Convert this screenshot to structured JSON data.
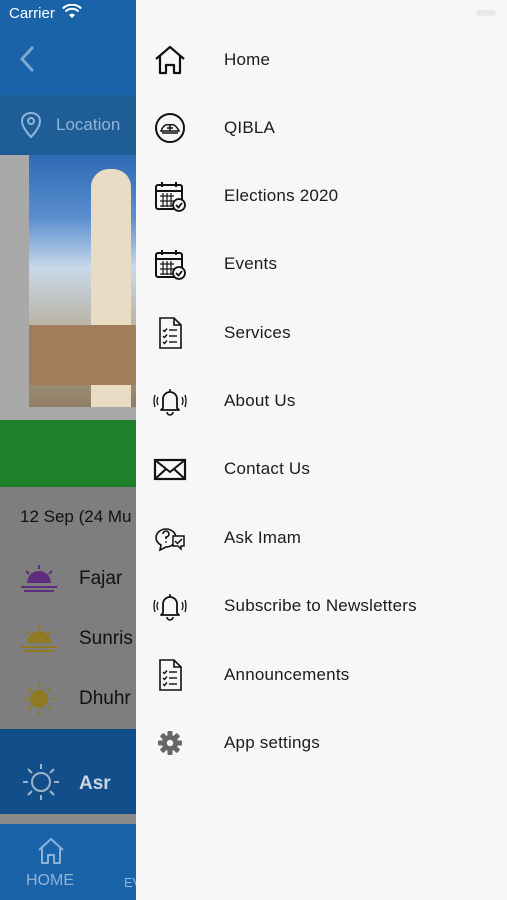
{
  "status_bar": {
    "carrier": "Carrier"
  },
  "background_app": {
    "location_label": "Location",
    "date_text": "12 Sep (24 Mu",
    "prayers": [
      "Fajar",
      "Sunris",
      "Dhuhr"
    ],
    "current_prayer": "Asr",
    "tabs": {
      "home_label": "HOME",
      "events_label": "EV"
    },
    "colors": {
      "header": "#1a63a8",
      "accent_green": "#1f7f2b",
      "current_prayer_bg": "#124f8a"
    }
  },
  "drawer": {
    "items": [
      {
        "label": "Home",
        "icon": "home-icon"
      },
      {
        "label": "QIBLA",
        "icon": "compass-icon"
      },
      {
        "label": "Elections 2020",
        "icon": "calendar-check-icon"
      },
      {
        "label": "Events",
        "icon": "calendar-check-icon"
      },
      {
        "label": "Services",
        "icon": "checklist-icon"
      },
      {
        "label": "About Us",
        "icon": "bell-icon"
      },
      {
        "label": "Contact Us",
        "icon": "envelope-icon"
      },
      {
        "label": "Ask Imam",
        "icon": "question-chat-icon"
      },
      {
        "label": "Subscribe to Newsletters",
        "icon": "bell-icon"
      },
      {
        "label": "Announcements",
        "icon": "checklist-icon"
      },
      {
        "label": "App settings",
        "icon": "gear-icon"
      }
    ]
  }
}
